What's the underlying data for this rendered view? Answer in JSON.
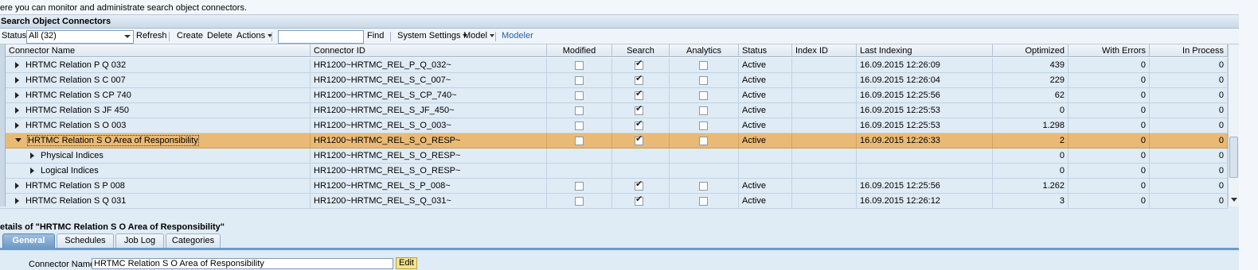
{
  "intro": "ere you can monitor and administrate search object connectors.",
  "panel_title": "Search Object Connectors",
  "toolbar": {
    "status_label": "Status:",
    "status_value": "All (32)",
    "refresh": "Refresh",
    "create": "Create",
    "delete": "Delete",
    "actions": "Actions",
    "find": "Find",
    "system_settings": "System Settings",
    "model": "Model",
    "modeler": "Modeler"
  },
  "columns": [
    "Connector Name",
    "Connector ID",
    "Modified",
    "Search",
    "Analytics",
    "Status",
    "Index ID",
    "Last Indexing",
    "Optimized",
    "With Errors",
    "In Process"
  ],
  "rows": [
    {
      "name": "HRTMC Relation P Q 032",
      "id": "HR1200~HRTMC_REL_P_Q_032~",
      "modified": false,
      "search": true,
      "analytics": false,
      "status": "Active",
      "index_id": "",
      "last": "16.09.2015 12:26:09",
      "optimized": "439",
      "errors": "0",
      "inproc": "0"
    },
    {
      "name": "HRTMC Relation S C 007",
      "id": "HR1200~HRTMC_REL_S_C_007~",
      "modified": false,
      "search": true,
      "analytics": false,
      "status": "Active",
      "index_id": "",
      "last": "16.09.2015 12:26:04",
      "optimized": "229",
      "errors": "0",
      "inproc": "0"
    },
    {
      "name": "HRTMC Relation S CP 740",
      "id": "HR1200~HRTMC_REL_S_CP_740~",
      "modified": false,
      "search": true,
      "analytics": false,
      "status": "Active",
      "index_id": "",
      "last": "16.09.2015 12:25:56",
      "optimized": "62",
      "errors": "0",
      "inproc": "0"
    },
    {
      "name": "HRTMC Relation S JF 450",
      "id": "HR1200~HRTMC_REL_S_JF_450~",
      "modified": false,
      "search": true,
      "analytics": false,
      "status": "Active",
      "index_id": "",
      "last": "16.09.2015 12:25:53",
      "optimized": "0",
      "errors": "0",
      "inproc": "0"
    },
    {
      "name": "HRTMC Relation S O 003",
      "id": "HR1200~HRTMC_REL_S_O_003~",
      "modified": false,
      "search": true,
      "analytics": false,
      "status": "Active",
      "index_id": "",
      "last": "16.09.2015 12:25:53",
      "optimized": "1.298",
      "errors": "0",
      "inproc": "0"
    },
    {
      "name": "HRTMC Relation S O Area of Responsibility",
      "id": "HR1200~HRTMC_REL_S_O_RESP~",
      "modified": false,
      "search": true,
      "analytics": false,
      "status": "Active",
      "index_id": "",
      "last": "16.09.2015 12:26:33",
      "optimized": "2",
      "errors": "0",
      "inproc": "0",
      "selected": true,
      "expanded": true
    },
    {
      "name": "Physical Indices",
      "id": "HR1200~HRTMC_REL_S_O_RESP~",
      "child": true,
      "status": "",
      "index_id": "",
      "last": "",
      "optimized": "0",
      "errors": "0",
      "inproc": "0"
    },
    {
      "name": "Logical Indices",
      "id": "HR1200~HRTMC_REL_S_O_RESP~",
      "child": true,
      "status": "",
      "index_id": "",
      "last": "",
      "optimized": "0",
      "errors": "0",
      "inproc": "0"
    },
    {
      "name": "HRTMC Relation S P 008",
      "id": "HR1200~HRTMC_REL_S_P_008~",
      "modified": false,
      "search": true,
      "analytics": false,
      "status": "Active",
      "index_id": "",
      "last": "16.09.2015 12:25:56",
      "optimized": "1.262",
      "errors": "0",
      "inproc": "0"
    },
    {
      "name": "HRTMC Relation S Q 031",
      "id": "HR1200~HRTMC_REL_S_Q_031~",
      "modified": false,
      "search": true,
      "analytics": false,
      "status": "Active",
      "index_id": "",
      "last": "16.09.2015 12:26:12",
      "optimized": "3",
      "errors": "0",
      "inproc": "0"
    }
  ],
  "details_title": "etails of \"HRTMC Relation S O Area of Responsibility\"",
  "tabs": [
    "General",
    "Schedules",
    "Job Log",
    "Categories"
  ],
  "form": {
    "connector_name_label": "Connector Name:",
    "connector_name_value": "HRTMC Relation S O Area of  Responsibility",
    "edit": "Edit"
  },
  "colors": {
    "selected_row": "#e9ba75",
    "row_bg": "#dfebf5",
    "active_tab": "#6f9ac4",
    "edit_button": "#f5e48a"
  }
}
